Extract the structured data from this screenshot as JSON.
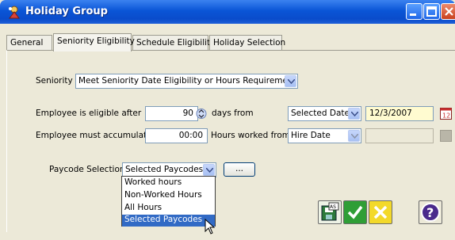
{
  "window": {
    "title": "Holiday Group",
    "controls": [
      "minimize-icon",
      "maximize-icon",
      "close-icon"
    ]
  },
  "tabs": [
    {
      "label": "General",
      "active": false
    },
    {
      "label": "Seniority Eligibility",
      "active": true
    },
    {
      "label": "Schedule Eligibility",
      "active": false
    },
    {
      "label": "Holiday Selection",
      "active": false
    }
  ],
  "seniority": {
    "label": "Seniority",
    "value": "Meet Seniority Date Eligibility or Hours Requirement"
  },
  "eligible_after": {
    "label": "Employee is eligible after",
    "value": "90",
    "days_from_label": "days from",
    "from_value": "Selected Date",
    "date_value": "12/3/2007"
  },
  "accumulate": {
    "label": "Employee must accumulate",
    "value": "00:00",
    "hours_from_label": "Hours worked from",
    "from_value": "Hire Date",
    "date_value": ""
  },
  "paycode": {
    "label": "Paycode Selection",
    "value": "Selected Paycodes",
    "browse_label": "...",
    "options": [
      "Worked hours",
      "Non-Worked Hours",
      "All Hours",
      "Selected Paycodes"
    ],
    "selected_index": 3
  },
  "actions": [
    "save-as-icon",
    "ok-check-icon",
    "cancel-x-icon",
    "help-icon"
  ],
  "colors": {
    "title_bar": "#0a55d6",
    "selection": "#316ac5",
    "date_field_bg": "#fffbd0",
    "ok_green": "#2f9e36",
    "cancel_yellow": "#f3d92a",
    "help_purple": "#4a2a8c"
  }
}
